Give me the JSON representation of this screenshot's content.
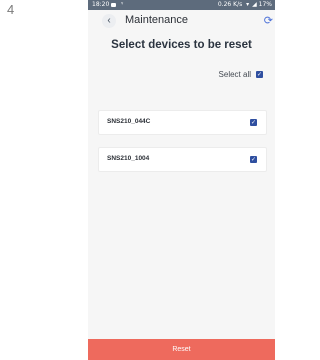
{
  "step_number": "4",
  "status_bar": {
    "time": "18:20",
    "misc": "ᵞ",
    "speed": "0.26 K/s",
    "battery": "17%"
  },
  "header": {
    "title": "Maintenance",
    "back_glyph": "‹",
    "sync_glyph": "⟳"
  },
  "page": {
    "heading": "Select devices to be reset",
    "select_all_label": "Select all",
    "select_all_checked": true
  },
  "devices": [
    {
      "name": "SNS210_044C",
      "checked": true
    },
    {
      "name": "SNS210_1004",
      "checked": true
    }
  ],
  "reset_button_label": "Reset",
  "colors": {
    "status_bar": "#5d6b7c",
    "checkbox": "#2f4fa0",
    "reset_button": "#ee6a5d",
    "sync_icon": "#4a6fd8"
  },
  "icons": {
    "back": "back-chevron-icon",
    "sync": "sync-icon",
    "checkbox": "checkbox-checked-icon"
  }
}
